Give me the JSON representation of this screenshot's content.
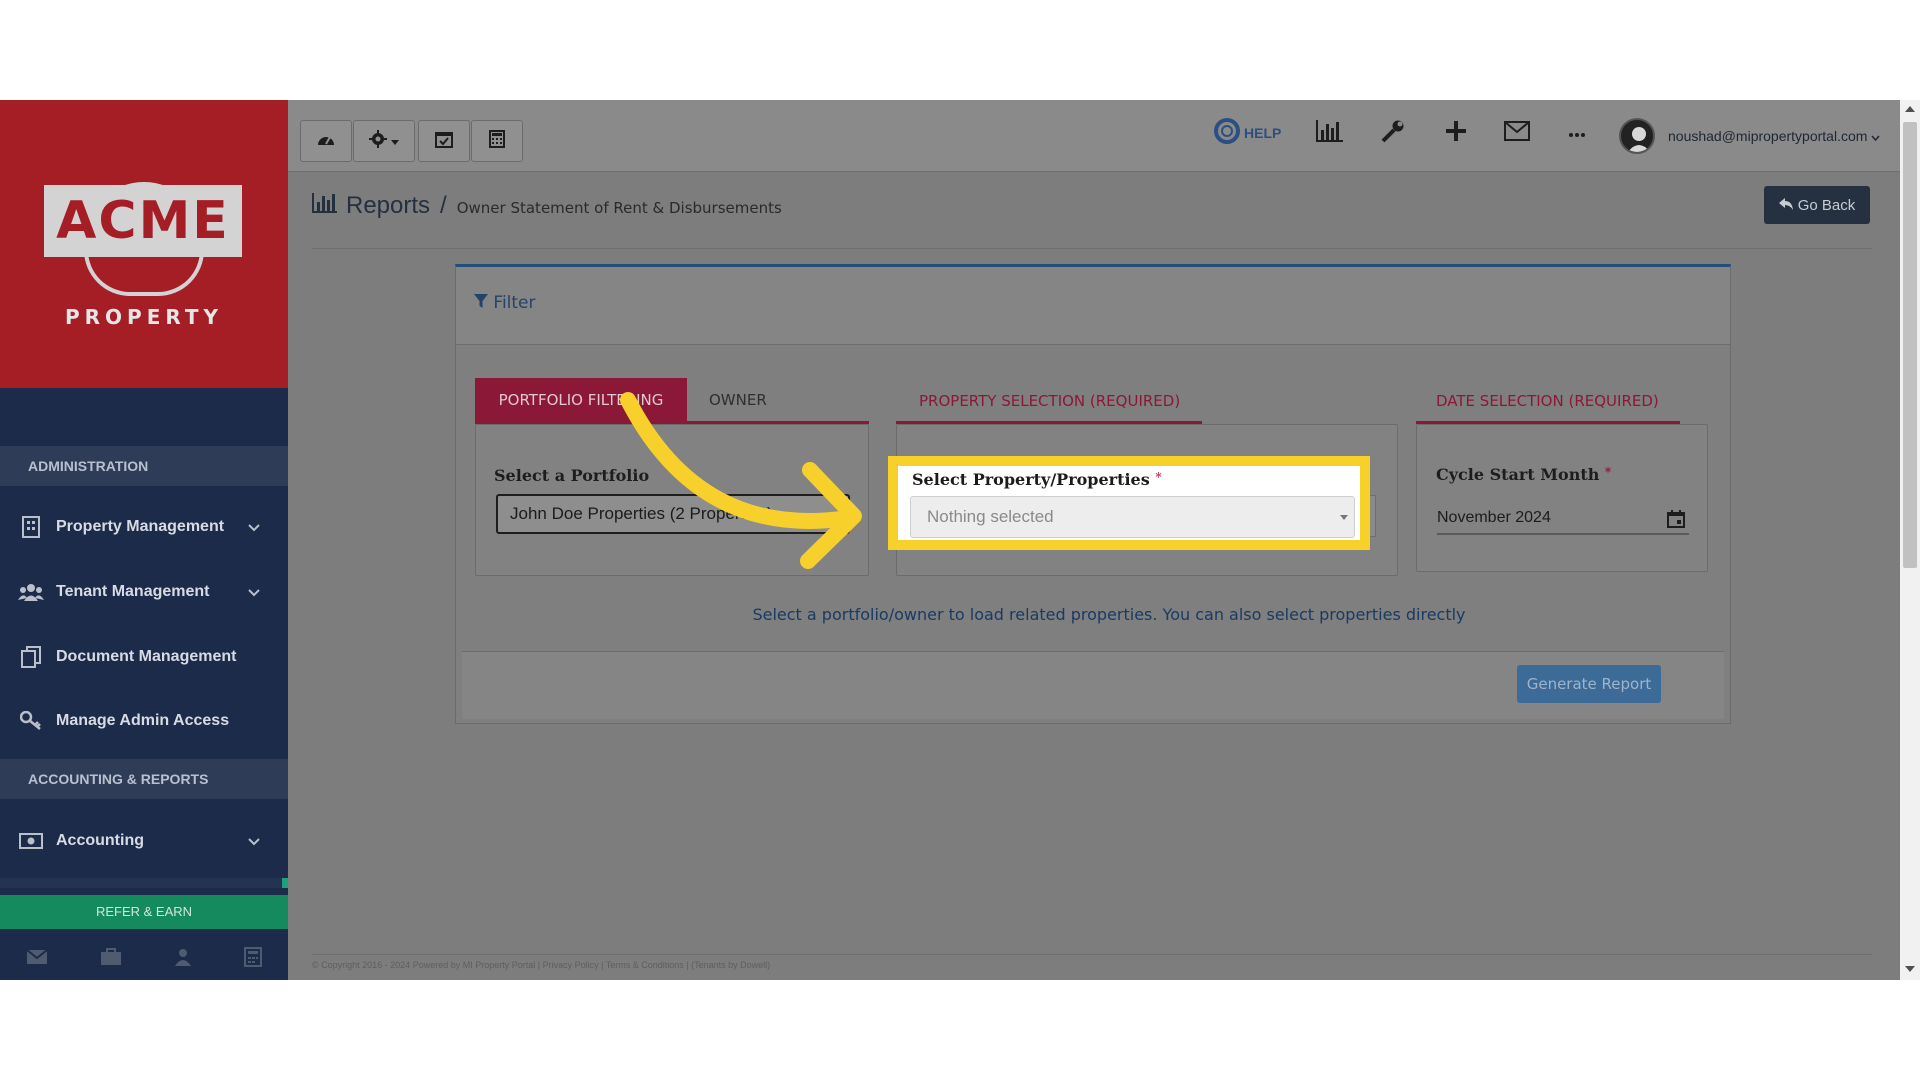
{
  "sidebar": {
    "logo_text": "ACME",
    "logo_subtext": "PROPERTY",
    "section_admin": "ADMINISTRATION",
    "items": [
      {
        "label": "Property Management",
        "icon": "building-icon"
      },
      {
        "label": "Tenant Management",
        "icon": "users-icon"
      },
      {
        "label": "Document Management",
        "icon": "documents-icon"
      },
      {
        "label": "Manage Admin Access",
        "icon": "key-icon"
      }
    ],
    "section_accounting": "ACCOUNTING & REPORTS",
    "accounting_item": {
      "label": "Accounting",
      "icon": "money-icon"
    },
    "refer_label": "REFER & EARN"
  },
  "topbar": {
    "help_label": "HELP",
    "user_email": "noushad@mipropertyportal.com"
  },
  "page": {
    "title": "Reports",
    "separator": "/",
    "subtitle": "Owner Statement of Rent & Disbursements",
    "go_back_label": "Go Back"
  },
  "filter": {
    "title": "Filter",
    "tabs": {
      "portfolio": "PORTFOLIO FILTERING",
      "owner": "OWNER",
      "property": "PROPERTY SELECTION (REQUIRED)",
      "date": "DATE SELECTION (REQUIRED)"
    },
    "portfolio_label": "Select a Portfolio",
    "portfolio_value": "John Doe Properties (2 Properties)",
    "property_label": "Select Property/Properties",
    "property_required_mark": "*",
    "property_placeholder": "Nothing selected",
    "date_label": "Cycle Start Month",
    "date_required_mark": "*",
    "date_value": "November 2024",
    "hint": "Select a portfolio/owner to load related properties. You can also select properties directly",
    "generate_label": "Generate Report"
  },
  "footer": {
    "text": "© Copyright 2016 - 2024 Powered by MI Property Portal | Privacy Policy | Terms & Conditions | (Tenants by Dowell)"
  },
  "colors": {
    "brand_red": "#a51d25",
    "sidebar_navy": "#1c2b4a",
    "tab_accent": "#8b1836",
    "highlight_yellow": "#f7d02c"
  }
}
